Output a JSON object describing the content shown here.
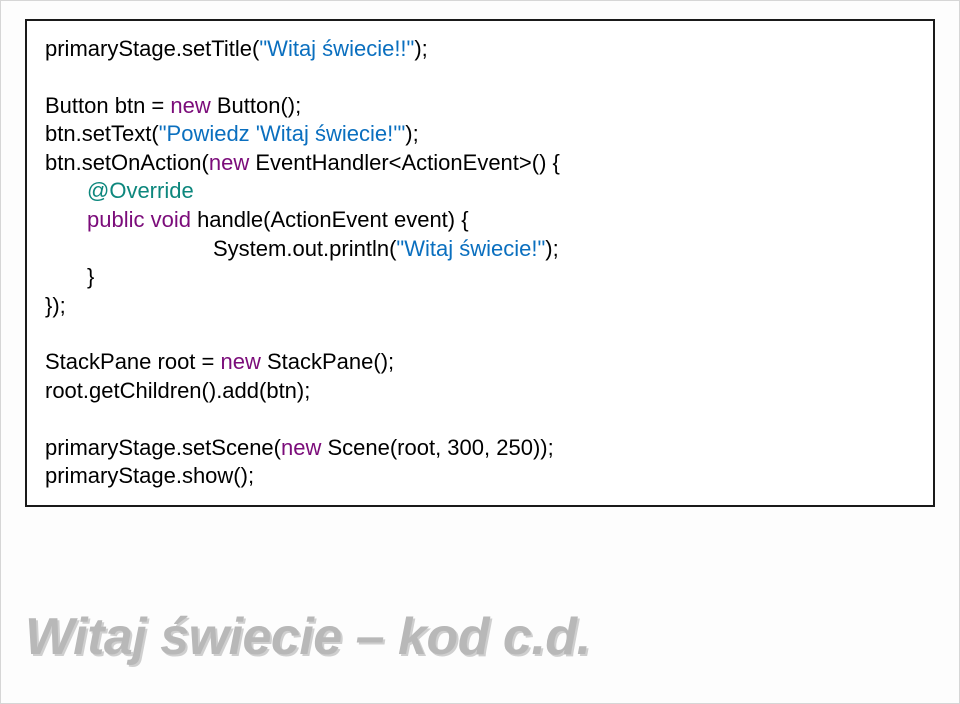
{
  "title": "Witaj świecie – kod c.d.",
  "code": {
    "l1_a": "primaryStage.setTitle(",
    "l1_b": "\"Witaj świecie!!\"",
    "l1_c": ");",
    "l2_a": "Button btn = ",
    "l2_b": "new",
    "l2_c": " Button();",
    "l3_a": "btn.setText(",
    "l3_b": "\"Powiedz 'Witaj świecie!'\"",
    "l3_c": ");",
    "l4_a": "btn.setOnAction(",
    "l4_b": "new",
    "l4_c": " EventHandler<ActionEvent>() {",
    "l5_a": "@Override",
    "l6_a": "public void",
    "l6_b": " handle(ActionEvent event) {",
    "l7_a": "System.out.println(",
    "l7_b": "\"Witaj świecie!\"",
    "l7_c": ");",
    "l8_a": "}",
    "l9_a": "});",
    "l10_a": "StackPane root = ",
    "l10_b": "new",
    "l10_c": " StackPane();",
    "l11_a": "root.getChildren().add(btn);",
    "l12_a": "primaryStage.setScene(",
    "l12_b": "new",
    "l12_c": " Scene(root, 300, 250));",
    "l13_a": "primaryStage.show();"
  }
}
